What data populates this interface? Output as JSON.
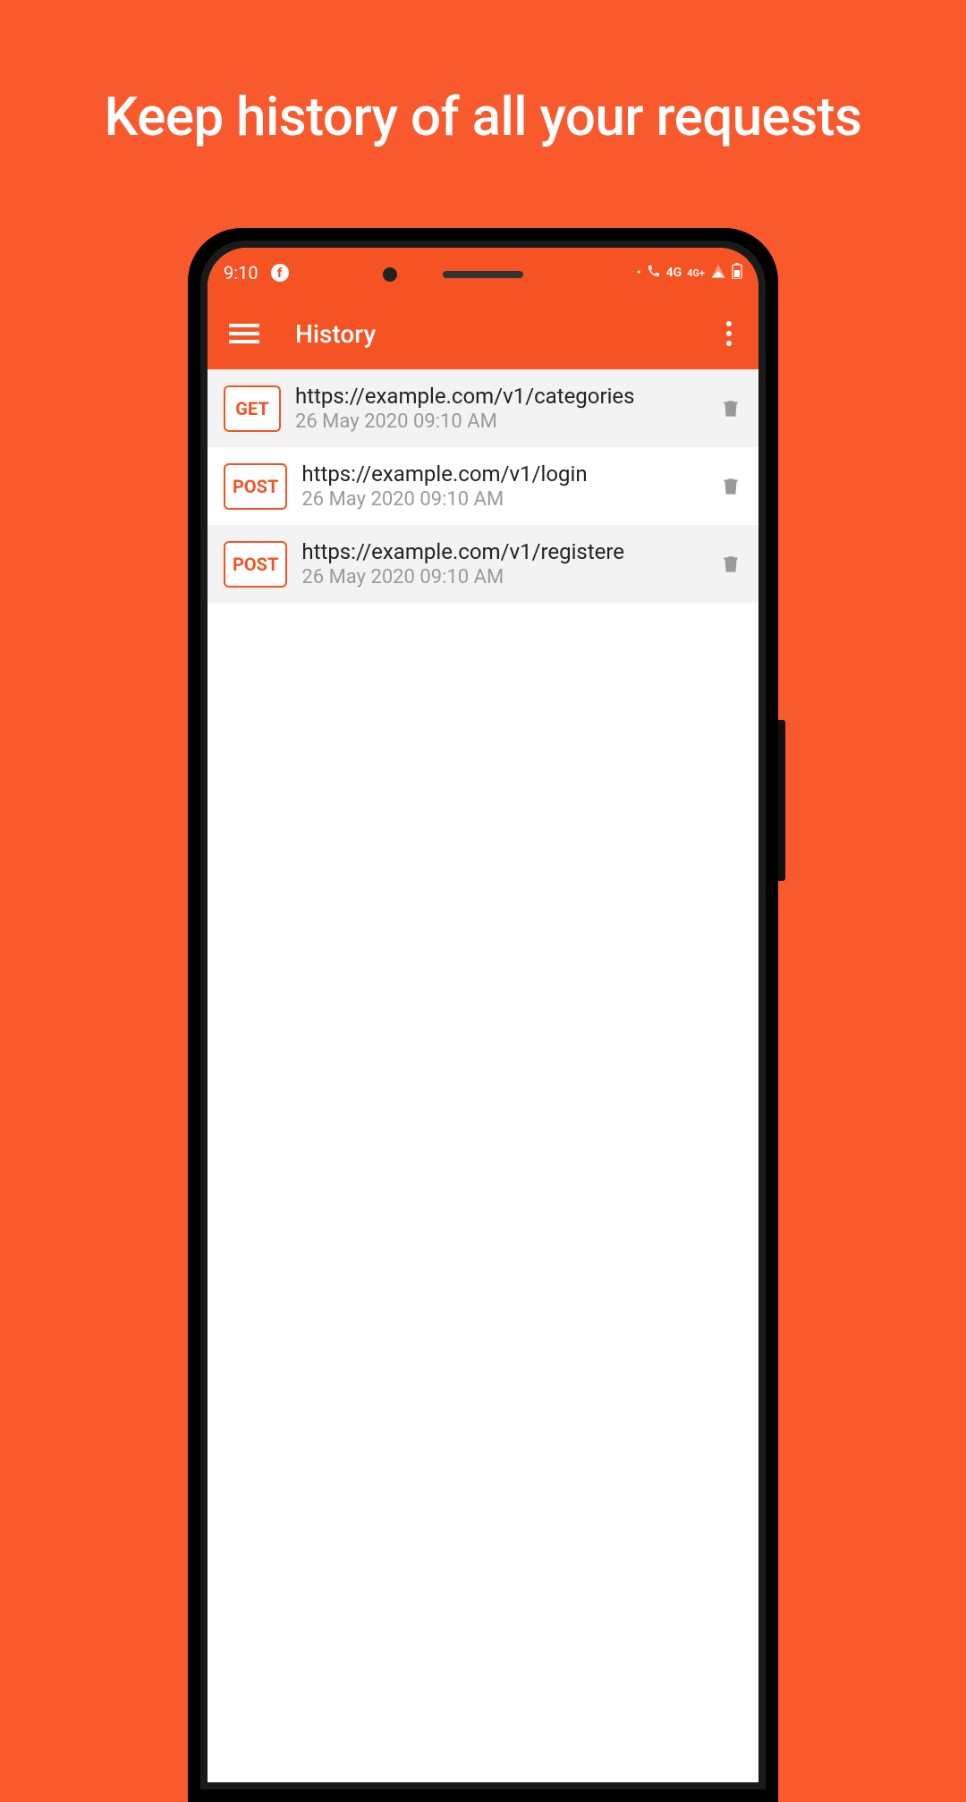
{
  "headline": "Keep history of all your requests",
  "status_bar": {
    "time": "9:10",
    "network_label": "4G",
    "network_plus": "4G+"
  },
  "app_bar": {
    "title": "History"
  },
  "history": [
    {
      "method": "GET",
      "url": "https://example.com/v1/categories",
      "date": "26 May 2020 09:10 AM"
    },
    {
      "method": "POST",
      "url": "https://example.com/v1/login",
      "date": "26 May 2020 09:10 AM"
    },
    {
      "method": "POST",
      "url": "https://example.com/v1/registere",
      "date": "26 May 2020 09:10 AM"
    }
  ],
  "colors": {
    "accent": "#f55323",
    "background": "#f85a2e"
  }
}
